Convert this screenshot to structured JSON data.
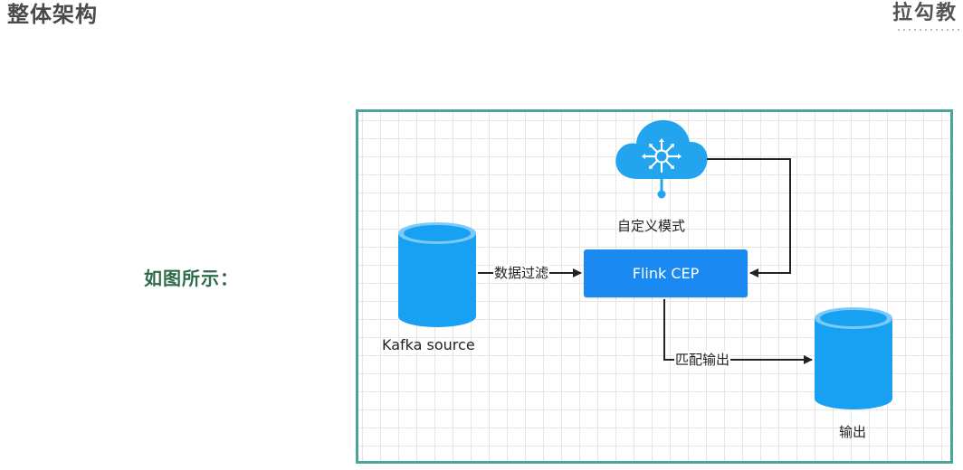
{
  "header": {
    "title": "整体架构",
    "brand": "拉勾教"
  },
  "caption": "如图所示：",
  "diagram": {
    "nodes": {
      "custom_pattern": "自定义模式",
      "kafka_source": "Kafka source",
      "flink_cep": "Flink CEP",
      "output": "输出"
    },
    "edges": {
      "data_filter": "数据过滤",
      "match_output": "匹配输出"
    }
  },
  "colors": {
    "frame_border": "#4aa49a",
    "node_blue": "#1a89f2",
    "cylinder_blue": "#18a1f3",
    "cloud_blue": "#23a4ef",
    "caption_green": "#2f6b4b"
  }
}
